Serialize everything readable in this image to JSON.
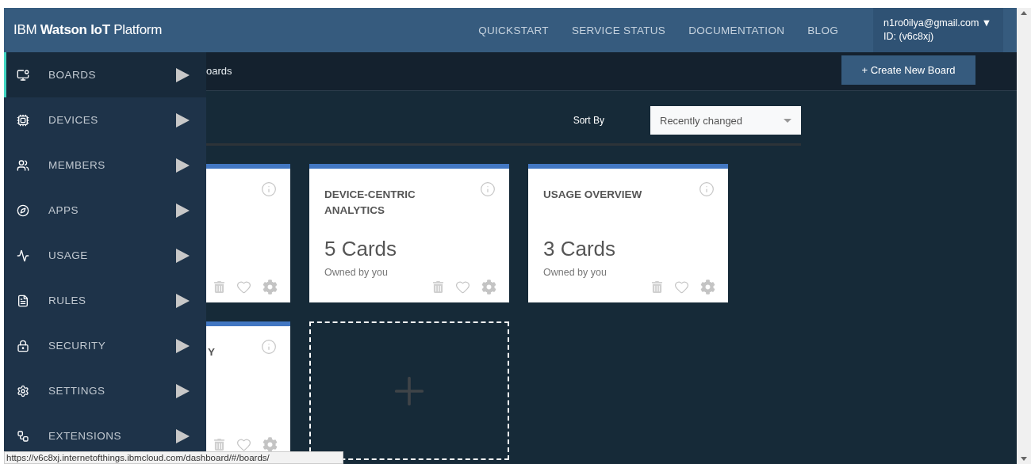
{
  "header": {
    "logo": "IBM **Watson IoT** Platform",
    "nav": [
      "QUICKSTART",
      "SERVICE STATUS",
      "DOCUMENTATION",
      "BLOG"
    ],
    "user": {
      "email": "n1ro0ilya@gmail.com",
      "caret": "▼",
      "id": "ID: (v6c8xj)"
    }
  },
  "sidebar": {
    "items": [
      {
        "label": "BOARDS",
        "selected": true
      },
      {
        "label": "DEVICES",
        "selected": false
      },
      {
        "label": "MEMBERS",
        "selected": false
      },
      {
        "label": "APPS",
        "selected": false
      },
      {
        "label": "USAGE",
        "selected": false
      },
      {
        "label": "RULES",
        "selected": false
      },
      {
        "label": "SECURITY",
        "selected": false
      },
      {
        "label": "SETTINGS",
        "selected": false
      },
      {
        "label": "EXTENSIONS",
        "selected": false
      }
    ]
  },
  "breadcrumb": "oards",
  "create_button": "+ Create New Board",
  "sort": {
    "label": "Sort By",
    "value": "Recently changed"
  },
  "boards": [
    {
      "kind": "partial"
    },
    {
      "kind": "board",
      "title": "DEVICE-CENTRIC ANALYTICS",
      "count": "5 Cards",
      "owner": "Owned by you"
    },
    {
      "kind": "board",
      "title": "USAGE OVERVIEW",
      "count": "3 Cards",
      "owner": "Owned by you"
    },
    {
      "kind": "partial",
      "title": "Y"
    },
    {
      "kind": "add"
    }
  ],
  "status_url": "https://v6c8xj.internetofthings.ibmcloud.com/dashboard/#/boards/"
}
